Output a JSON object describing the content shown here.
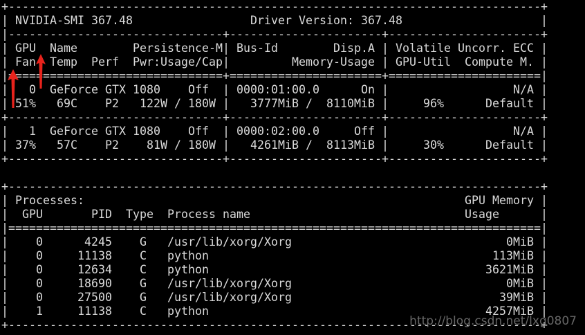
{
  "terminal": {
    "lines": [
      "+-----------------------------------------------------------------------------+",
      "| NVIDIA-SMI 367.48                 Driver Version: 367.48                    |",
      "|-------------------------------+----------------------+----------------------+",
      "| GPU  Name        Persistence-M| Bus-Id        Disp.A | Volatile Uncorr. ECC |",
      "| Fan  Temp  Perf  Pwr:Usage/Cap|         Memory-Usage | GPU-Util  Compute M. |",
      "|===============================+======================+======================|",
      "|   0  GeForce GTX 1080    Off  | 0000:01:00.0      On |                  N/A |",
      "| 51%   69C    P2   122W / 180W |   3777MiB /  8110MiB |     96%      Default |",
      "+-------------------------------+----------------------+----------------------+",
      "|   1  GeForce GTX 1080    Off  | 0000:02:00.0     Off |                  N/A |",
      "| 37%   57C    P2    81W / 180W |   4261MiB /  8113MiB |     30%      Default |",
      "+-------------------------------+----------------------+----------------------+",
      "",
      "+-----------------------------------------------------------------------------+",
      "| Processes:                                                       GPU Memory |",
      "|  GPU       PID  Type  Process name                               Usage      |",
      "|=============================================================================|",
      "|    0      4245    G   /usr/lib/xorg/Xorg                               0MiB |",
      "|    0     11138    C   python                                         113MiB |",
      "|    0     12634    C   python                                        3621MiB |",
      "|    0     18690    G   /usr/lib/xorg/Xorg                               0MiB |",
      "|    0     27500    G   /usr/lib/xorg/Xorg                              39MiB |",
      "|    1     11138    C   python                                        4257MiB |",
      "+-----------------------------------------------------------------------------+"
    ]
  },
  "annotations": {
    "arrow_color": "#e8231c",
    "arrow_icon": "red-up-arrow-icon"
  },
  "watermark": {
    "text": "http://blog.csdn.net/lxg0807"
  },
  "colors": {
    "background": "#000000",
    "text": "#d9d9d9",
    "watermark": "#7a7a7a"
  }
}
